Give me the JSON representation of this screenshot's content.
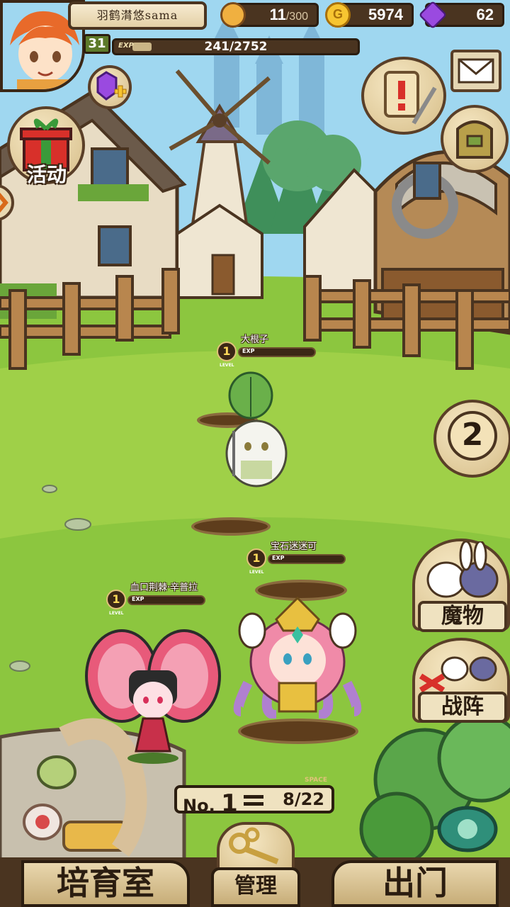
{
  "player": {
    "name": "羽鹤潸悠sama",
    "level": "31",
    "exp_label": "EXP",
    "exp_text": "241/2752",
    "exp_fraction": 0.0876
  },
  "resources": {
    "stamina": {
      "value": "11",
      "max": "/300",
      "icon": "bread-icon"
    },
    "gold": {
      "value": "5974",
      "icon": "gold-coin-icon"
    },
    "gems": {
      "value": "62",
      "icon": "purple-gem-icon"
    }
  },
  "menus": {
    "event_label": "活动",
    "monster_label": "魔物",
    "team_label": "战阵",
    "stage_number": "2"
  },
  "monsters": [
    {
      "level": "1",
      "level_label": "LEVEL",
      "name": "大根子",
      "exp_label": "EXP"
    },
    {
      "level": "1",
      "level_label": "LEVEL",
      "name": "宝石迷迷可",
      "exp_label": "EXP"
    },
    {
      "level": "1",
      "level_label": "LEVEL",
      "name": "血口荆棘·辛普拉",
      "exp_label": "EXP"
    }
  ],
  "space": {
    "no_label": "No.",
    "no_value": "1",
    "space_label": "SPACE",
    "value": "8/22"
  },
  "bottom_nav": {
    "nursery": "培育室",
    "manage": "管理",
    "exit": "出门"
  },
  "colors": {
    "grass": "#8cc63f",
    "wood_dark": "#4a3420",
    "parchment": "#efe2c0",
    "sky": "#9fd7f0"
  }
}
